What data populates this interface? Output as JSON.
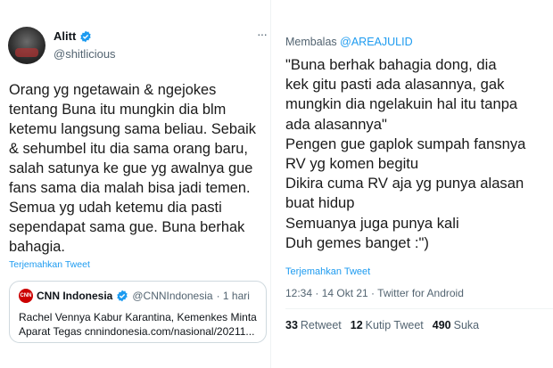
{
  "left": {
    "author": {
      "name": "Alitt",
      "handle": "@shitlicious"
    },
    "more_glyph": "···",
    "text": "Orang yg ngetawain & ngejokes\ntentang Buna itu mungkin dia blm\nketemu langsung sama beliau. Sebaik\n& sehumbel itu dia sama orang baru,\nsalah satunya ke gue yg awalnya gue\nfans sama dia malah bisa jadi temen.\nSemua yg udah ketemu dia pasti\nsependapat sama gue. Buna berhak\nbahagia.",
    "translate": "Terjemahkan Tweet",
    "quote": {
      "logo": "CNN",
      "name": "CNN Indonesia",
      "handle": "@CNNIndonesia",
      "time": "· 1 hari",
      "line1": "Rachel Vennya Kabur Karantina, Kemenkes Minta",
      "line2": "Aparat Tegas cnnindonesia.com/nasional/20211..."
    }
  },
  "right": {
    "reply_prefix": "Membalas ",
    "reply_handle": "@AREAJULID",
    "text": "\"Buna berhak bahagia dong, dia\nkek gitu pasti ada alasannya, gak\nmungkin dia ngelakuin hal itu tanpa\nada alasannya\"\nPengen gue gaplok sumpah fansnya\nRV yg komen begitu\nDikira cuma RV aja yg punya alasan\nbuat hidup\nSemuanya juga punya kali\nDuh gemes banget :\")",
    "translate": "Terjemahkan Tweet",
    "meta": "12:34 · 14 Okt 21 · Twitter for Android",
    "stats": {
      "retweet_count": "33",
      "retweet_label": "Retweet",
      "quote_count": "12",
      "quote_label": "Kutip Tweet",
      "like_count": "490",
      "like_label": "Suka"
    }
  },
  "colors": {
    "link": "#1d9bf0",
    "muted": "#536471",
    "cnn_red": "#cc0000"
  },
  "icons": [
    "verified-badge-icon",
    "more-options-icon",
    "cnn-logo-icon"
  ]
}
